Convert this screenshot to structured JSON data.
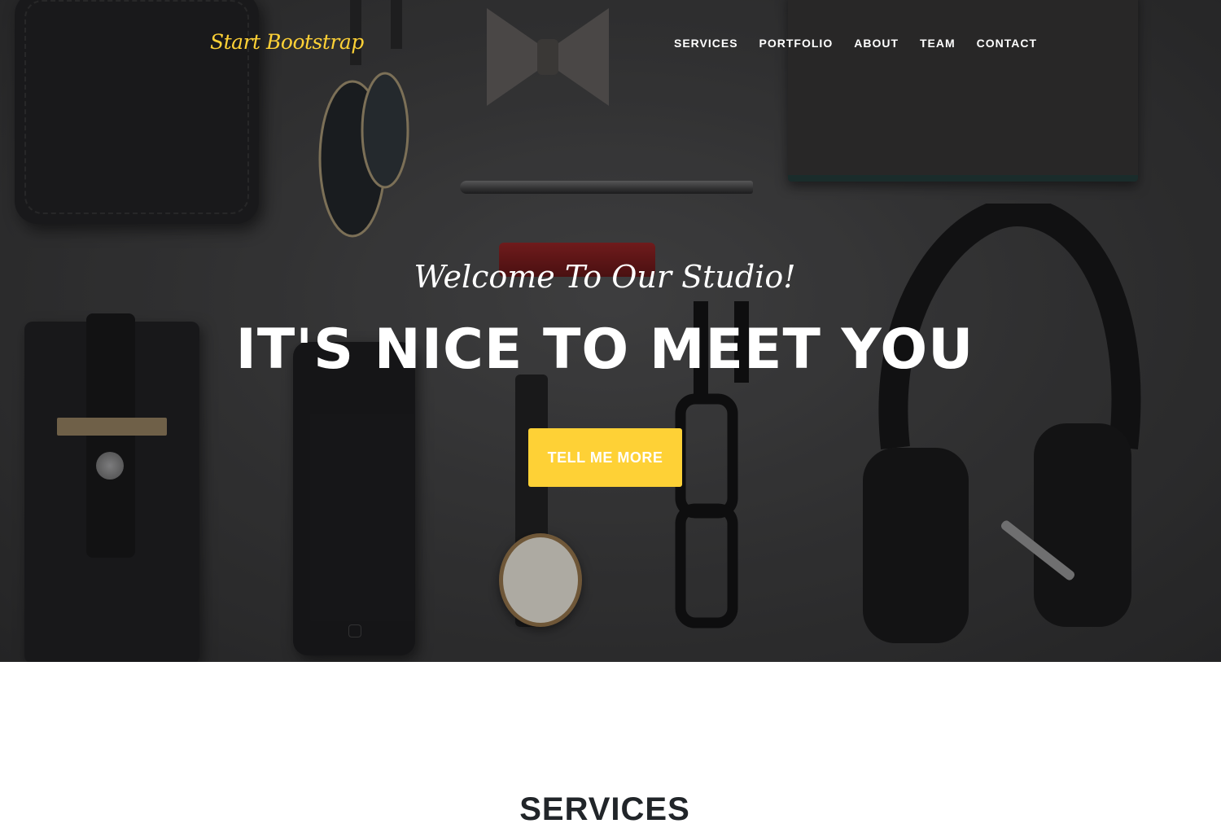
{
  "nav": {
    "brand": "Start Bootstrap",
    "items": [
      {
        "label": "SERVICES"
      },
      {
        "label": "PORTFOLIO"
      },
      {
        "label": "ABOUT"
      },
      {
        "label": "TEAM"
      },
      {
        "label": "CONTACT"
      }
    ]
  },
  "hero": {
    "lead_in": "Welcome To Our Studio!",
    "heading": "IT'S NICE TO MEET YOU",
    "cta_label": "TELL ME MORE"
  },
  "services": {
    "heading": "SERVICES"
  },
  "colors": {
    "accent": "#fed136",
    "heading_dark": "#212529"
  }
}
